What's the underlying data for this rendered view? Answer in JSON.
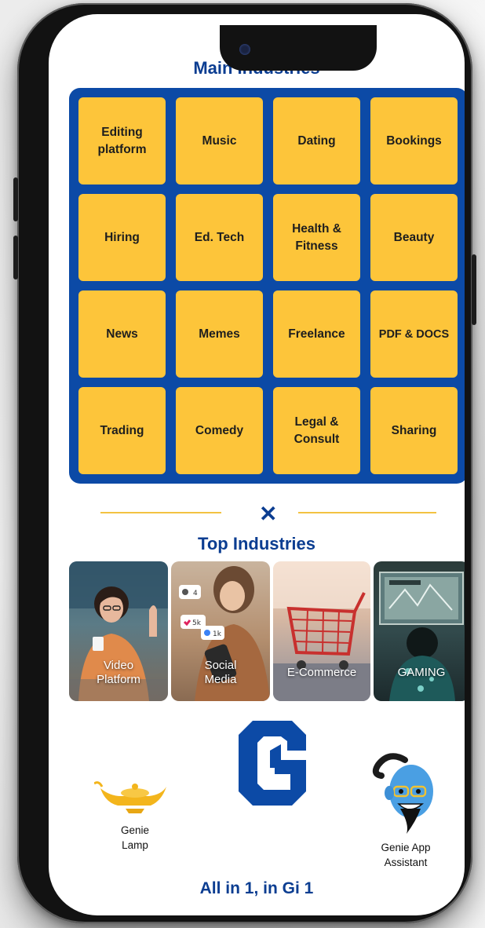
{
  "main_section": {
    "title": "Main Industries",
    "items": [
      {
        "label": "Editing platform"
      },
      {
        "label": "Music"
      },
      {
        "label": "Dating"
      },
      {
        "label": "Bookings"
      },
      {
        "label": "Hiring"
      },
      {
        "label": "Ed. Tech"
      },
      {
        "label": "Health & Fitness"
      },
      {
        "label": "Beauty"
      },
      {
        "label": "News"
      },
      {
        "label": "Memes"
      },
      {
        "label": "Freelance"
      },
      {
        "label": "PDF & DOCS"
      },
      {
        "label": "Trading"
      },
      {
        "label": "Comedy"
      },
      {
        "label": "Legal & Consult"
      },
      {
        "label": "Sharing"
      }
    ]
  },
  "divider": {
    "icon": "x-icon",
    "glyph": "✕"
  },
  "top_section": {
    "title": "Top Industries",
    "tiles": [
      {
        "label_line1": "Video",
        "label_line2": "Platform",
        "icon": "video-platform-photo"
      },
      {
        "label_line1": "Social",
        "label_line2": "Media",
        "icon": "social-media-photo",
        "badges": [
          "4",
          "5k",
          "1k"
        ]
      },
      {
        "label_line1": "E-Commerce",
        "label_line2": "",
        "icon": "shopping-cart-photo"
      },
      {
        "label_line1": "GAMING",
        "label_line2": "",
        "icon": "gaming-photo"
      }
    ]
  },
  "bottom": {
    "logo_icon": "gi1-logo-icon",
    "lamp_label_line1": "Genie",
    "lamp_label_line2": "Lamp",
    "assistant_label_line1": "Genie App",
    "assistant_label_line2": "Assistant",
    "tagline": "All in 1, in Gi 1"
  },
  "colors": {
    "brand_blue": "#0b3d91",
    "grid_blue": "#0c4aa6",
    "tile_yellow": "#fdc53a",
    "phone_frame": "#121212"
  }
}
